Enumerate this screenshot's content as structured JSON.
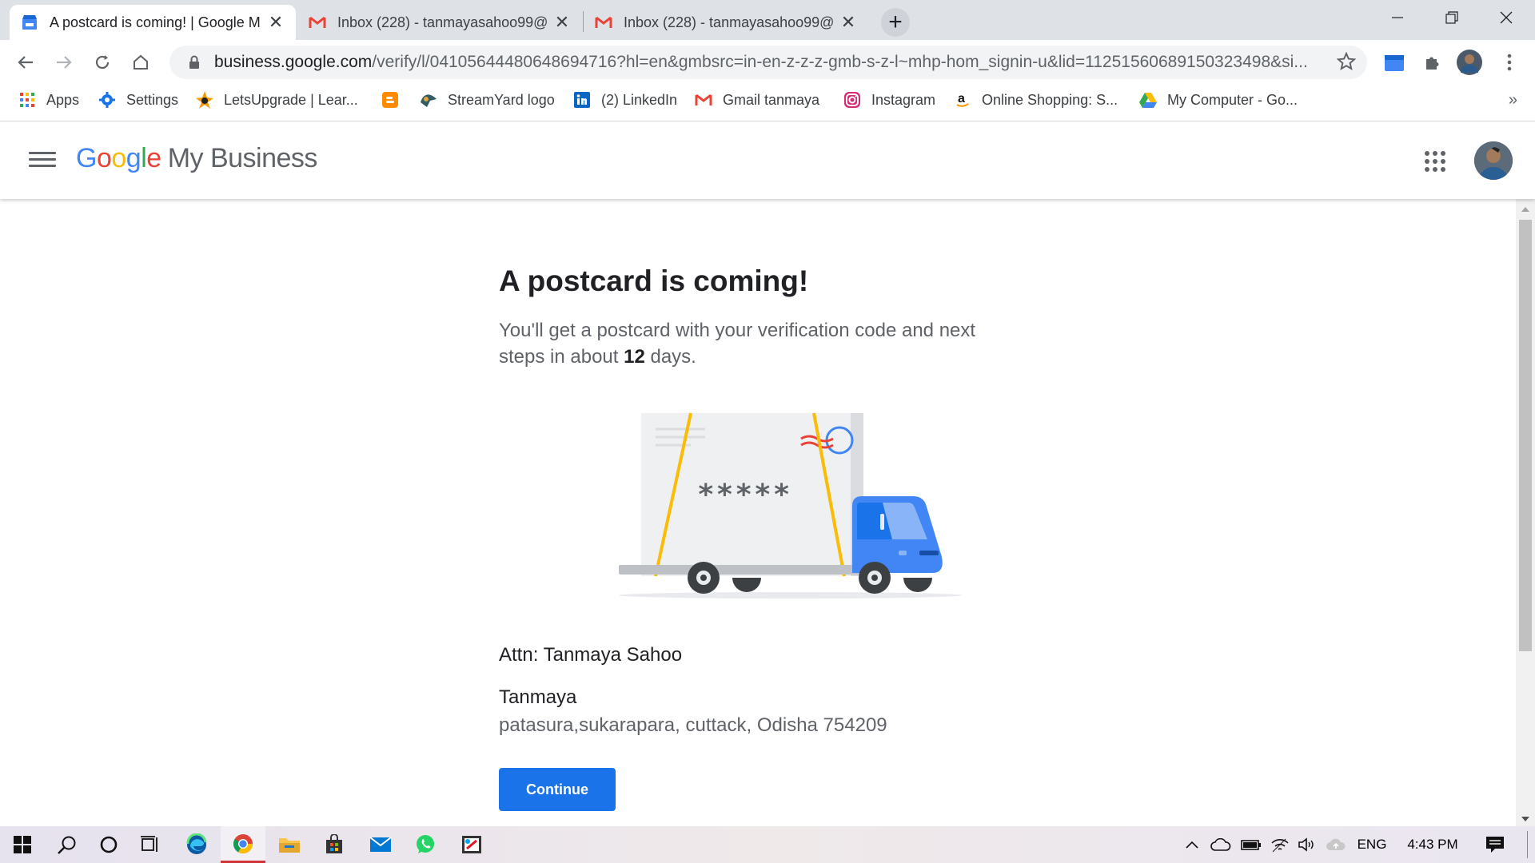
{
  "browser": {
    "tabs": [
      {
        "title": "A postcard is coming! | Google M",
        "icon": "gmb-store-icon",
        "active": true
      },
      {
        "title": "Inbox (228) - tanmayasahoo99@",
        "icon": "gmail-icon",
        "active": false
      },
      {
        "title": "Inbox (228) - tanmayasahoo99@",
        "icon": "gmail-icon",
        "active": false
      }
    ],
    "url_host": "business.google.com",
    "url_path": "/verify/l/04105644480648694716?hl=en&gmbsrc=in-en-z-z-z-gmb-s-z-l~mhp-hom_signin-u&lid=11251560689150323498&si...",
    "bookmarks": [
      {
        "label": "Apps",
        "icon": "apps-grid-icon"
      },
      {
        "label": "Settings",
        "icon": "gear-icon"
      },
      {
        "label": "LetsUpgrade | Lear...",
        "icon": "letsupgrade-icon"
      },
      {
        "label": "",
        "icon": "blogger-icon"
      },
      {
        "label": "StreamYard logo",
        "icon": "streamyard-icon"
      },
      {
        "label": "(2) LinkedIn",
        "icon": "linkedin-icon"
      },
      {
        "label": "Gmail  tanmaya",
        "icon": "gmail-icon"
      },
      {
        "label": "Instagram",
        "icon": "instagram-icon"
      },
      {
        "label": "Online Shopping: S...",
        "icon": "amazon-icon"
      },
      {
        "label": "My Computer - Go...",
        "icon": "google-drive-icon"
      }
    ],
    "bookmarks_more": "»"
  },
  "header": {
    "brand_letters": [
      "G",
      "o",
      "o",
      "g",
      "l",
      "e"
    ],
    "product": "My Business"
  },
  "main": {
    "headline": "A postcard is coming!",
    "subtext_before": "You'll get a postcard with your verification code and next steps in about ",
    "subtext_days": "12",
    "subtext_after": " days.",
    "postcard_code": "*****",
    "attn": "Attn: Tanmaya Sahoo",
    "address_name": "Tanmaya",
    "address_line": "patasura,sukarapara, cuttack, Odisha 754209",
    "continue_label": "Continue"
  },
  "taskbar": {
    "language": "ENG",
    "time": "4:43 PM"
  },
  "colors": {
    "primary_blue": "#1a73e8",
    "google_blue": "#4285f4",
    "google_red": "#ea4335",
    "google_yellow": "#fbbc05",
    "google_green": "#34a853"
  }
}
